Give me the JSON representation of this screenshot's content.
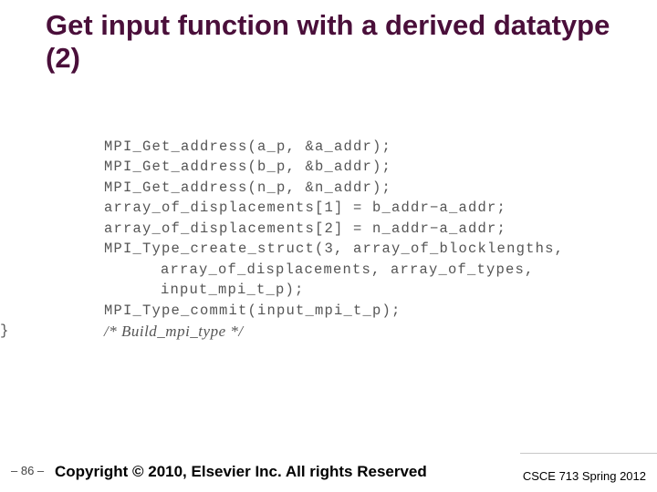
{
  "title": "Get input function with a derived datatype (2)",
  "code": {
    "l1": "MPI_Get_address(a_p, &a_addr);",
    "l2": "MPI_Get_address(b_p, &b_addr);",
    "l3": "MPI_Get_address(n_p, &n_addr);",
    "l4": "array_of_displacements[1] = b_addr−a_addr;",
    "l5": "array_of_displacements[2] = n_addr−a_addr;",
    "l6": "MPI_Type_create_struct(3, array_of_blocklengths,",
    "l7": "array_of_displacements, array_of_types,",
    "l8": "input_mpi_t_p);",
    "l9": "MPI_Type_commit(input_mpi_t_p);",
    "close": "}",
    "comment": "/*  Build_mpi_type  */"
  },
  "footer": {
    "page": "– 86 –",
    "copyright": "Copyright © 2010, Elsevier Inc. All rights Reserved",
    "course": "CSCE 713 Spring 2012"
  }
}
